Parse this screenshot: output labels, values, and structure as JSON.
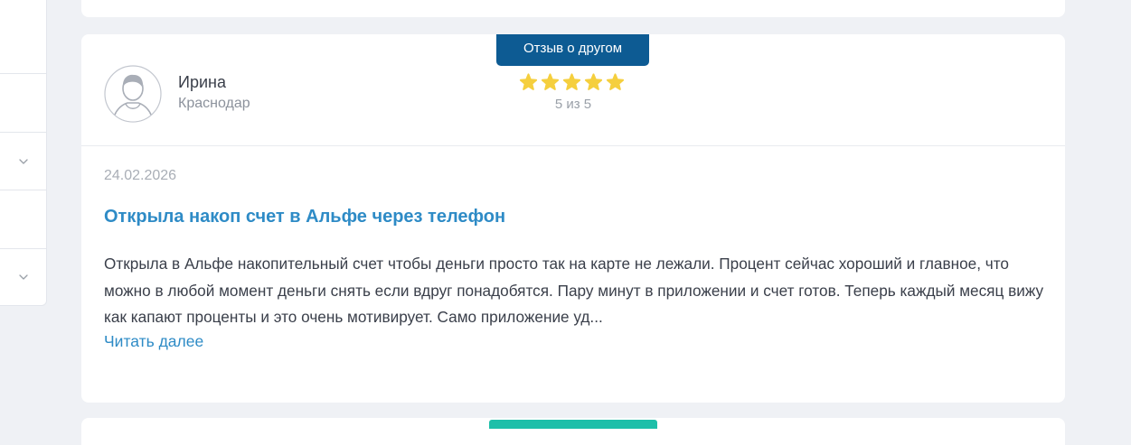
{
  "review": {
    "badge": "Отзыв о другом",
    "author": {
      "name": "Ирина",
      "city": "Краснодар"
    },
    "rating": {
      "value": 5,
      "max": 5,
      "text": "5 из 5"
    },
    "date": "24.02.2026",
    "title": "Открыла накоп счет в Альфе через телефон",
    "text": "Открыла в Альфе накопительный счет чтобы деньги просто так на карте не лежали. Процент сейчас хороший и главное, что можно в любой момент деньги снять если вдруг понадобятся. Пару минут в приложении и счет готов. Теперь каждый месяц вижу как капают проценты и это очень мотивирует. Само приложение уд...",
    "read_more": "Читать далее"
  },
  "colors": {
    "page_bg": "#eff1f5",
    "badge_bg": "#0d5b93",
    "link": "#2e8bc6",
    "star": "#f5cf3e",
    "next_badge": "#1ebfa9"
  },
  "icons": {
    "avatar": "user-avatar-icon",
    "star": "star-icon",
    "chevron": "chevron-down-icon"
  }
}
